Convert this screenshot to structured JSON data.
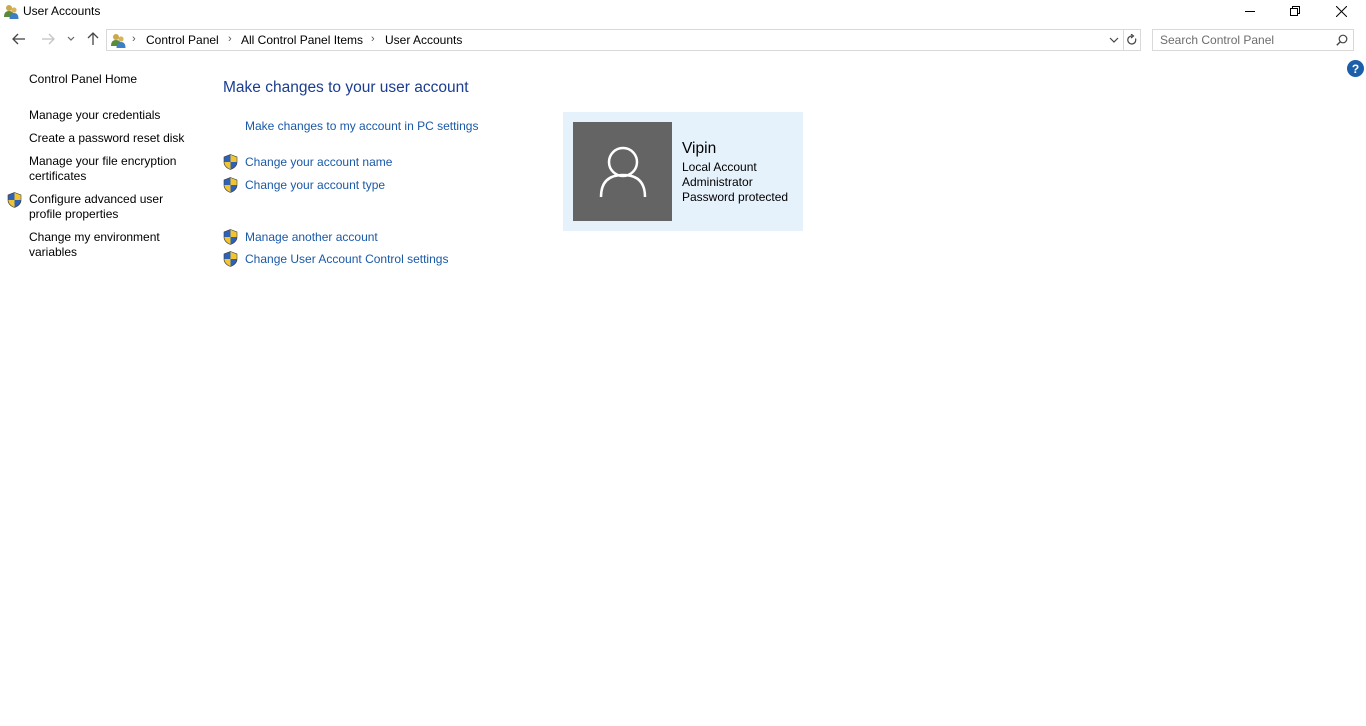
{
  "window": {
    "title": "User Accounts",
    "app_icon": "user-accounts-icon",
    "controls": {
      "minimize": "minimize-icon",
      "maximize": "restore-icon",
      "close": "close-icon"
    }
  },
  "navigation": {
    "back": "back-arrow-icon",
    "forward": "forward-arrow-icon",
    "recent": "chevron-down-icon",
    "up": "up-arrow-icon",
    "breadcrumb": [
      "Control Panel",
      "All Control Panel Items",
      "User Accounts"
    ],
    "breadcrumb_separator": "›",
    "search": {
      "placeholder": "Search Control Panel",
      "value": ""
    },
    "help_label": "?"
  },
  "sidebar": {
    "home_label": "Control Panel Home",
    "items": [
      {
        "label": "Manage your credentials",
        "shield": false
      },
      {
        "label": "Create a password reset disk",
        "shield": false
      },
      {
        "label": "Manage your file encryption certificates",
        "shield": false
      },
      {
        "label": "Configure advanced user profile properties",
        "shield": true
      },
      {
        "label": "Change my environment variables",
        "shield": false
      }
    ]
  },
  "main": {
    "heading": "Make changes to your user account",
    "pc_settings_link": "Make changes to my account in PC settings",
    "tasks_group1": [
      {
        "label": "Change your account name",
        "shield": true
      },
      {
        "label": "Change your account type",
        "shield": true
      }
    ],
    "tasks_group2": [
      {
        "label": "Manage another account",
        "shield": true
      },
      {
        "label": "Change User Account Control settings",
        "shield": true
      }
    ]
  },
  "account": {
    "name": "Vipin",
    "type": "Local Account",
    "role": "Administrator",
    "password_status": "Password protected",
    "avatar_icon": "user-silhouette-icon"
  },
  "colors": {
    "link": "#1a59a8",
    "heading": "#1a3d8f",
    "card_bg": "#e5f1fb",
    "avatar_bg": "#646464",
    "help_bg": "#1c5fa8"
  }
}
